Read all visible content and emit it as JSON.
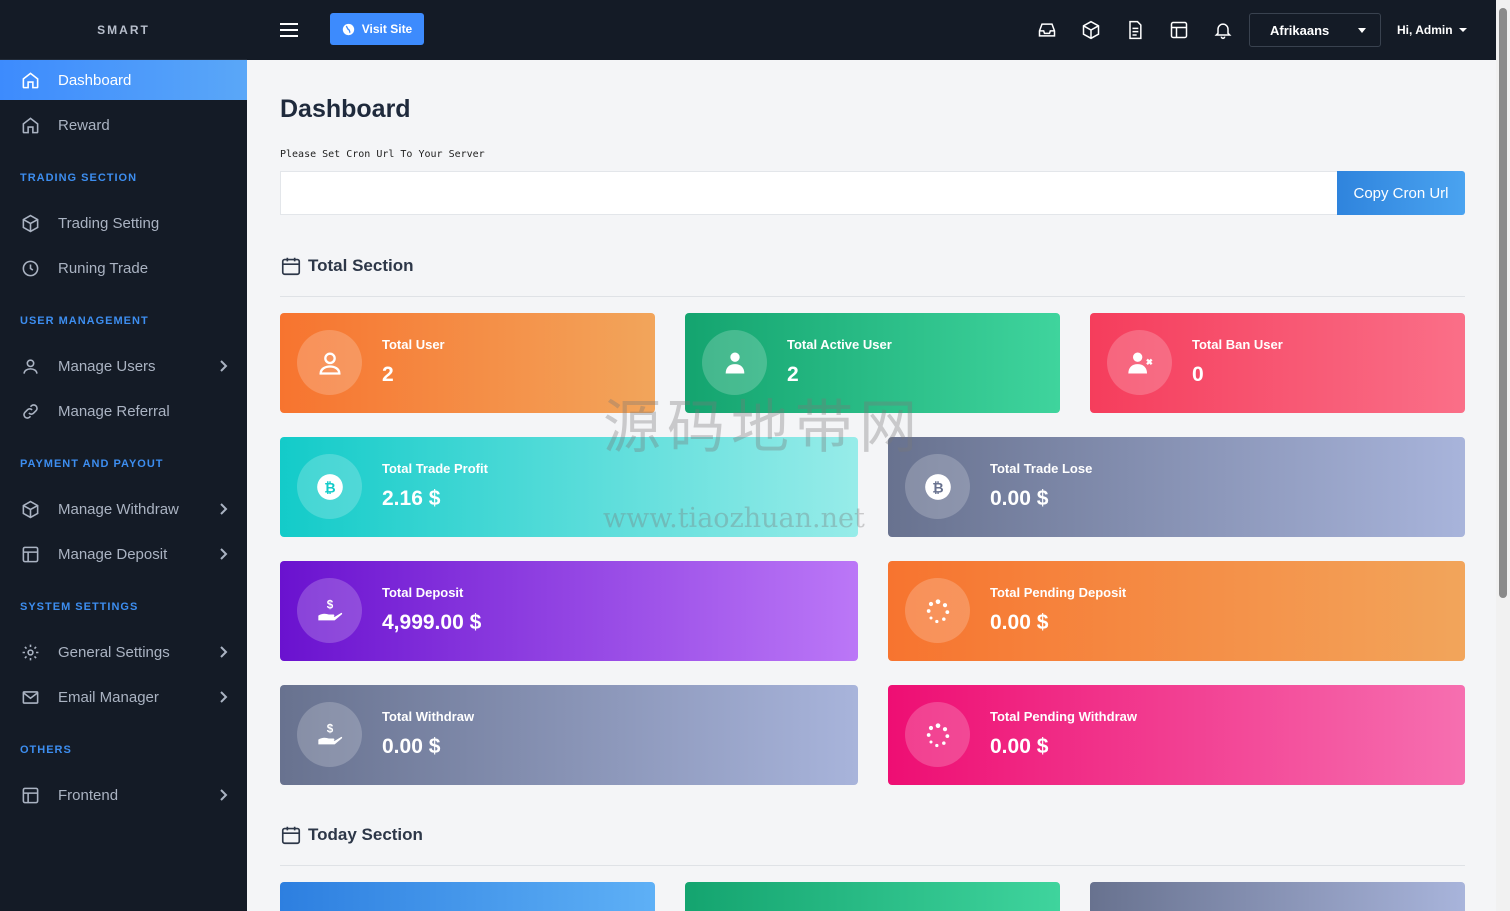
{
  "brand": "SMART",
  "sidebar": {
    "items": [
      {
        "label": "Dashboard",
        "icon": "home-icon"
      },
      {
        "label": "Reward",
        "icon": "home-icon"
      },
      {
        "label": "Trading Setting",
        "icon": "cube-icon"
      },
      {
        "label": "Runing Trade",
        "icon": "clock-icon"
      },
      {
        "label": "Manage Users",
        "icon": "user-icon"
      },
      {
        "label": "Manage Referral",
        "icon": "link-icon"
      },
      {
        "label": "Manage Withdraw",
        "icon": "cube-icon"
      },
      {
        "label": "Manage Deposit",
        "icon": "layout-icon"
      },
      {
        "label": "General Settings",
        "icon": "gear-icon"
      },
      {
        "label": "Email Manager",
        "icon": "mail-icon"
      },
      {
        "label": "Frontend",
        "icon": "layout-icon"
      }
    ],
    "sections": [
      "TRADING SECTION",
      "USER MANAGEMENT",
      "PAYMENT AND PAYOUT",
      "SYSTEM SETTINGS",
      "OTHERS"
    ]
  },
  "topbar": {
    "visit_site": "Visit Site",
    "language": "Afrikaans",
    "user_greeting": "Hi, Admin"
  },
  "main": {
    "title": "Dashboard",
    "cron_label": "Please Set Cron Url To Your Server",
    "cron_value": "",
    "copy_button": "Copy Cron Url",
    "total_section": "Total Section",
    "today_section": "Today Section"
  },
  "cards": {
    "total_user": {
      "label": "Total User",
      "value": "2"
    },
    "total_active_user": {
      "label": "Total Active User",
      "value": "2"
    },
    "total_ban_user": {
      "label": "Total Ban User",
      "value": "0"
    },
    "total_trade_profit": {
      "label": "Total Trade Profit",
      "value": "2.16 $"
    },
    "total_trade_lose": {
      "label": "Total Trade Lose",
      "value": "0.00 $"
    },
    "total_deposit": {
      "label": "Total Deposit",
      "value": "4,999.00 $"
    },
    "total_pending_deposit": {
      "label": "Total Pending Deposit",
      "value": "0.00 $"
    },
    "total_withdraw": {
      "label": "Total Withdraw",
      "value": "0.00 $"
    },
    "total_pending_withdraw": {
      "label": "Total Pending Withdraw",
      "value": "0.00 $"
    }
  },
  "watermark": {
    "cn": "源码地带网",
    "url": "www.tiaozhuan.net"
  },
  "colors": {
    "accent": "#3d8bfd",
    "sidebar_bg": "#141b26",
    "section_label": "#3d8ef0"
  }
}
